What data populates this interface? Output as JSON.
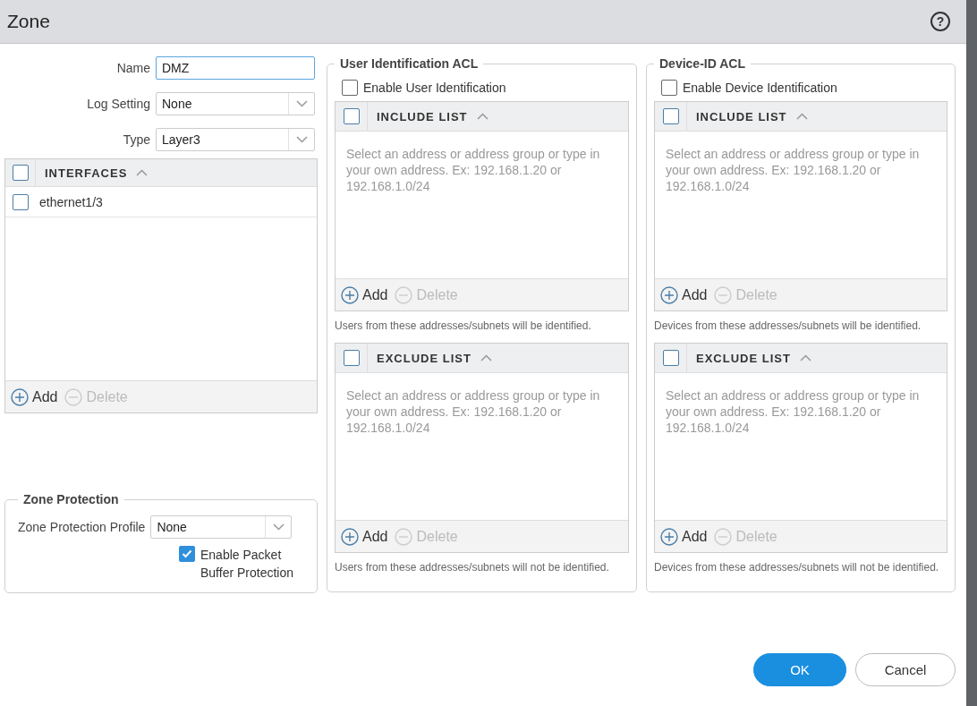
{
  "window": {
    "title": "Zone",
    "help": "?"
  },
  "general": {
    "fields": [
      {
        "kind": "text",
        "label": "Name",
        "value": "DMZ"
      },
      {
        "kind": "select",
        "label": "Log Setting",
        "value": "None"
      },
      {
        "kind": "select",
        "label": "Type",
        "value": "Layer3"
      }
    ]
  },
  "interfaces": {
    "header": "INTERFACES",
    "header_checked": false,
    "rows": [
      {
        "name": "ethernet1/3",
        "checked": false
      }
    ],
    "actions": [
      {
        "label": "Add",
        "kind": "add",
        "disabled": false
      },
      {
        "label": "Delete",
        "kind": "delete",
        "disabled": true
      }
    ]
  },
  "zone_protection": {
    "title": "Zone Protection",
    "profile_label": "Zone Protection Profile",
    "profile_value": "None",
    "buffer_label": "Enable Packet Buffer Protection",
    "buffer_checked": true
  },
  "acls": [
    {
      "title": "User Identification ACL",
      "enable_label": "Enable User Identification",
      "enabled": false,
      "lists": [
        {
          "header": "INCLUDE LIST",
          "checked": false,
          "empty_text": "Select an address or address group or type in your own address. Ex: 192.168.1.20 or 192.168.1.0/24",
          "actions": [
            {
              "label": "Add",
              "kind": "add",
              "disabled": false
            },
            {
              "label": "Delete",
              "kind": "delete",
              "disabled": true
            }
          ],
          "note": "Users from these addresses/subnets will be identified."
        },
        {
          "header": "EXCLUDE LIST",
          "checked": false,
          "empty_text": "Select an address or address group or type in your own address. Ex: 192.168.1.20 or 192.168.1.0/24",
          "actions": [
            {
              "label": "Add",
              "kind": "add",
              "disabled": false
            },
            {
              "label": "Delete",
              "kind": "delete",
              "disabled": true
            }
          ],
          "note": "Users from these addresses/subnets will not be identified."
        }
      ]
    },
    {
      "title": "Device-ID ACL",
      "enable_label": "Enable Device Identification",
      "enabled": false,
      "lists": [
        {
          "header": "INCLUDE LIST",
          "checked": false,
          "empty_text": "Select an address or address group or type in your own address. Ex: 192.168.1.20 or 192.168.1.0/24",
          "actions": [
            {
              "label": "Add",
              "kind": "add",
              "disabled": false
            },
            {
              "label": "Delete",
              "kind": "delete",
              "disabled": true
            }
          ],
          "note": "Devices from these addresses/subnets will be identified."
        },
        {
          "header": "EXCLUDE LIST",
          "checked": false,
          "empty_text": "Select an address or address group or type in your own address. Ex: 192.168.1.20 or 192.168.1.0/24",
          "actions": [
            {
              "label": "Add",
              "kind": "add",
              "disabled": false
            },
            {
              "label": "Delete",
              "kind": "delete",
              "disabled": true
            }
          ],
          "note": "Devices from these addresses/subnets will not be identified."
        }
      ]
    }
  ],
  "buttons": [
    {
      "label": "OK",
      "kind": "primary"
    },
    {
      "label": "Cancel",
      "kind": "secondary"
    }
  ]
}
